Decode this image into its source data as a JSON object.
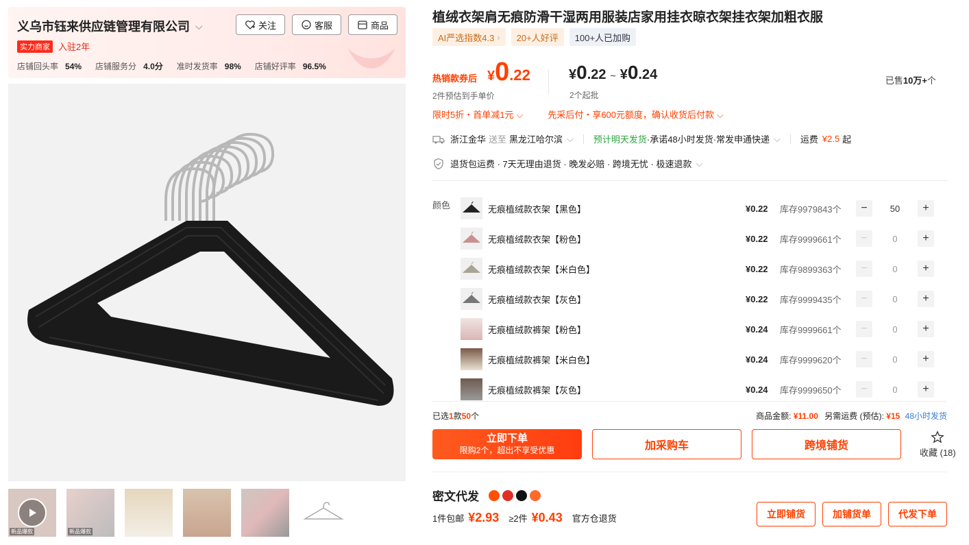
{
  "shop": {
    "name": "义乌市钰来供应链管理有限公司",
    "badge": "实力商家",
    "years": "入驻2年",
    "stats": [
      {
        "label": "店铺回头率",
        "value": "54%"
      },
      {
        "label": "店铺服务分",
        "value": "4.0分"
      },
      {
        "label": "准时发货率",
        "value": "98%"
      },
      {
        "label": "店铺好评率",
        "value": "96.5%"
      }
    ],
    "follow_label": "关注",
    "service_label": "客服",
    "goods_label": "商品"
  },
  "product": {
    "title": "植绒衣架肩无痕防滑干湿两用服装店家用挂衣晾衣架挂衣架加粗衣服",
    "tags": {
      "ai": "AI严选指数4.3",
      "ai_chev": "›",
      "good": "20+人好评",
      "buy": "100+人已加购"
    }
  },
  "price": {
    "hot_label": "热销款券后",
    "hot_yen": "¥",
    "hot_int": "0",
    "hot_dec": ".22",
    "hot_sub": "2件预估到手单价",
    "range_yen1": "¥",
    "range_int1": "0",
    "range_dec1": ".22",
    "range_tilde": "~",
    "range_yen2": "¥",
    "range_int2": "0",
    "range_dec2": ".24",
    "range_sub": "2个起批",
    "sold_prefix": "已售",
    "sold_value": "10万+",
    "sold_suffix": "个"
  },
  "promo": {
    "left": "限时5折・首单减1元",
    "right": "先采后付・享600元额度，确认收货后付款",
    "chev": "⌵"
  },
  "shipping": {
    "from": "浙江金华",
    "to_word": "送至",
    "to": "黑龙江哈尔滨",
    "chev": "⌵",
    "eta": "预计明天发货",
    "promise": "·承诺48小时发货·常发申通快递",
    "fee_label": "运费",
    "fee_value": "¥2.5",
    "fee_suffix": "起"
  },
  "services": {
    "text": "退货包运费 · 7天无理由退货 · 晚发必赔 · 跨境无忧 · 极速退款",
    "chev": "⌵"
  },
  "sku": {
    "color_label": "颜色",
    "rows": [
      {
        "name": "无痕植绒款衣架【黑色】",
        "price": "¥0.22",
        "stock": "库存9979843个",
        "qty": "50"
      },
      {
        "name": "无痕植绒款衣架【粉色】",
        "price": "¥0.22",
        "stock": "库存9999661个",
        "qty": "0"
      },
      {
        "name": "无痕植绒款衣架【米白色】",
        "price": "¥0.22",
        "stock": "库存9899363个",
        "qty": "0"
      },
      {
        "name": "无痕植绒款衣架【灰色】",
        "price": "¥0.22",
        "stock": "库存9999435个",
        "qty": "0"
      },
      {
        "name": "无痕植绒款裤架【粉色】",
        "price": "¥0.24",
        "stock": "库存9999661个",
        "qty": "0"
      },
      {
        "name": "无痕植绒款裤架【米白色】",
        "price": "¥0.24",
        "stock": "库存9999620个",
        "qty": "0"
      },
      {
        "name": "无痕植绒款裤架【灰色】",
        "price": "¥0.24",
        "stock": "库存9999650个",
        "qty": "0"
      }
    ],
    "minus": "−",
    "plus": "+"
  },
  "summary": {
    "selected_prefix": "已选",
    "selected_kinds": "1",
    "selected_mid": "款",
    "selected_count": "50",
    "selected_suffix": "个",
    "amount_label": "商品金额:",
    "amount_value": "¥11.00",
    "freight_label": "另需运费 (预估):",
    "freight_value": "¥15",
    "freight_note": "48小时发货"
  },
  "actions": {
    "buy_now": "立即下单",
    "buy_now_sub": "限购2个，超出不享受优惠",
    "add_cart": "加采购车",
    "cross_border": "跨境铺货",
    "favorite": "收藏 (18)"
  },
  "dropship": {
    "title": "密文代发",
    "one_prefix": "1件包邮",
    "one_price": "¥2.93",
    "two_prefix": "≥2件",
    "two_price": "¥0.43",
    "return_note": "官方仓退货",
    "btn_list": "立即铺货",
    "btn_add": "加铺货单",
    "btn_order": "代发下单"
  },
  "thumbs": {
    "t1_tag": "新品爆款",
    "t2_tag": "新品爆款"
  },
  "colors": {
    "accent": "#ff4000",
    "badge_red": "#ff2a1a",
    "green": "#2aa640",
    "blue": "#3a7bd5"
  }
}
